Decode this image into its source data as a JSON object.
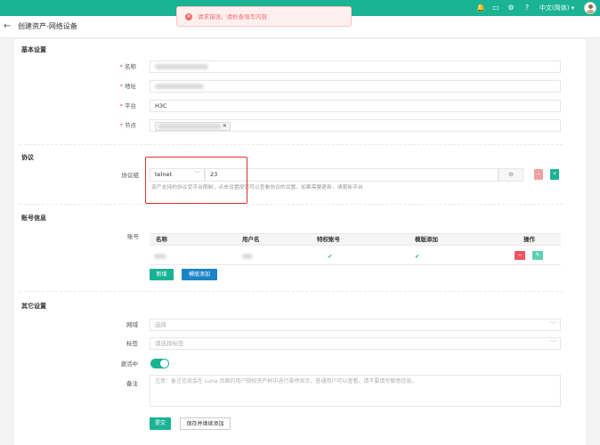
{
  "topbar": {
    "icons": [
      "bell-icon",
      "terminal-icon",
      "gear-icon",
      "help-icon"
    ],
    "language": "中文(简体)",
    "accent": "#1ab394"
  },
  "page": {
    "title": "创建资产-网络设备"
  },
  "toast": {
    "message": "请求错误，请检查填写内容",
    "color": "#f56c6c"
  },
  "basic": {
    "section_title": "基本设置",
    "name_label": "名称",
    "address_label": "地址",
    "platform_label": "平台",
    "platform_value": "H3C",
    "node_label": "节点"
  },
  "protocol": {
    "section_title": "协议",
    "group_label": "协议组",
    "protocol_value": "telnet",
    "port_value": "23",
    "help_text": "资产支持的协议受平台限制，点击设置按钮可以查看协议的设置。如果需要更新，请更新平台"
  },
  "accounts": {
    "section_title": "账号信息",
    "label": "账号",
    "columns": [
      "名称",
      "用户名",
      "特权账号",
      "模版添加",
      "操作"
    ],
    "rows": [
      {
        "privileged": "✔",
        "template": "✔"
      }
    ],
    "add_button": "新增",
    "template_add_button": "模版添加"
  },
  "other": {
    "section_title": "其它设置",
    "domain_label": "网域",
    "domain_placeholder": "选择",
    "labels_label": "标签",
    "labels_placeholder": "请选择标签",
    "active_label": "激活中",
    "active": true,
    "comment_label": "备注",
    "comment_placeholder": "注意：备注信息会在 Luna 页面的用户授权资产树中进行悬停显示，普通用户可以查看，请不要填写敏感信息。"
  },
  "footer": {
    "submit_button": "提交",
    "save_continue_button": "保存并继续添加"
  }
}
